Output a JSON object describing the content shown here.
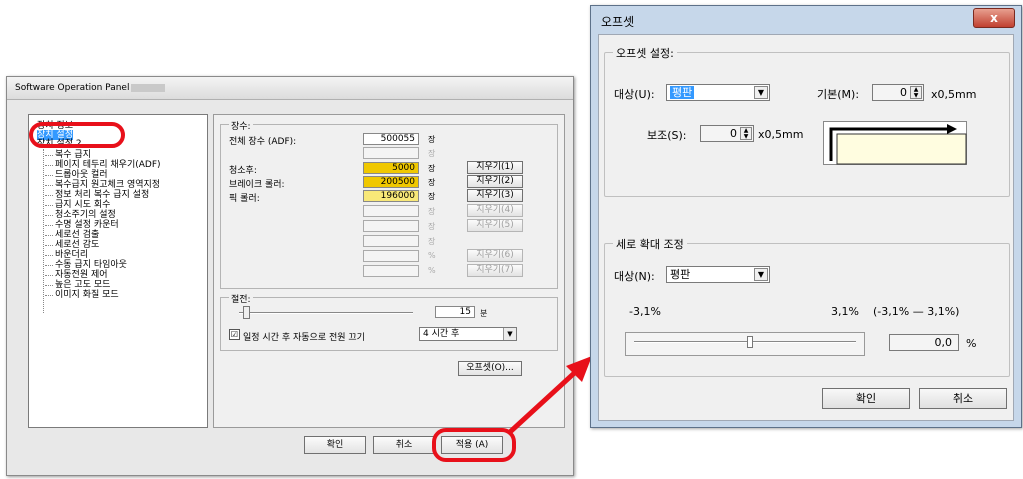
{
  "sop": {
    "title": "Software Operation Panel",
    "tree": {
      "items": [
        "장치 정보",
        "장치 설정",
        "장치 설정 2"
      ],
      "subitems": [
        "복수 급지",
        "페이지 테두리 채우기(ADF)",
        "드롭아웃 컬러",
        "복수급지 원고체크 영역지정",
        "정보 처리 복수 급지 설정",
        "급지 시도 회수",
        "청소주기의 설정",
        "수명 설정 카운터",
        "세로선 검출",
        "세로선 감도",
        "바운더리",
        "수동 급지 타임아웃",
        "자동전원 제어",
        "높은 고도 모드",
        "이미지 화질 모드"
      ]
    },
    "count_group": {
      "legend": "장수:",
      "total_label": "전체 장수 (ADF):",
      "total_value": "500055",
      "unit": "장",
      "pct_unit": "%",
      "rows": [
        {
          "label": "청소후:",
          "value": "5000",
          "button": "지우기(1)"
        },
        {
          "label": "브레이크 롤러:",
          "value": "200500",
          "button": "지우기(2)"
        },
        {
          "label": "픽 롤러:",
          "value": "196000",
          "button": "지우기(3)"
        }
      ],
      "disabled_buttons": [
        "지우기(4)",
        "지우기(5)",
        "지우기(6)",
        "지우기(7)"
      ]
    },
    "power_group": {
      "legend": "절전:",
      "minutes_value": "15",
      "minutes_unit": "분",
      "auto_off_label": "일정 시간 후 자동으로 전원 끄기",
      "auto_off_checked": "☑",
      "auto_off_value": "4 시간 후"
    },
    "offset_button": "오프셋(O)...",
    "buttons": {
      "ok": "확인",
      "cancel": "취소",
      "apply": "적용 (A)"
    }
  },
  "offset": {
    "title": "오프셋",
    "close": "x",
    "offset_group": {
      "legend": "오프셋 설정:",
      "target_label": "대상(U):",
      "target_value": "평판",
      "base_label": "기본(M):",
      "base_value": "0",
      "base_unit": "x0,5mm",
      "sub_label": "보조(S):",
      "sub_value": "0",
      "sub_unit": "x0,5mm"
    },
    "zoom_group": {
      "legend": "세로 확대 조정",
      "target_label": "대상(N):",
      "target_value": "평판",
      "min_label": "-3,1%",
      "max_label": "3,1%",
      "range_label": "(-3,1% — 3,1%)",
      "value": "0,0",
      "unit": "%"
    },
    "buttons": {
      "ok": "확인",
      "cancel": "취소"
    }
  },
  "colors": {
    "highlight": "#e8101a",
    "yellow": "#f0c800",
    "selection": "#3399ff"
  }
}
